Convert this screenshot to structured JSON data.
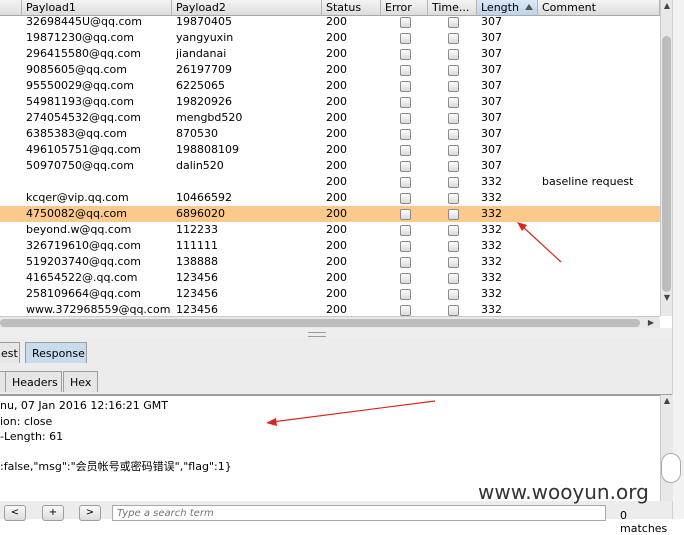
{
  "table": {
    "columns": [
      "Payload1",
      "Payload2",
      "Status",
      "Error",
      "Time...",
      "Length",
      "Comment"
    ],
    "rows": [
      {
        "p1": "32698445U@qq.com",
        "p2": "19870405",
        "status": "200",
        "length": "307",
        "comment": ""
      },
      {
        "p1": "19871230@qq.com",
        "p2": "yangyuxin",
        "status": "200",
        "length": "307",
        "comment": ""
      },
      {
        "p1": "296415580@qq.com",
        "p2": "jiandanai",
        "status": "200",
        "length": "307",
        "comment": ""
      },
      {
        "p1": "9085605@qq.com",
        "p2": "26197709",
        "status": "200",
        "length": "307",
        "comment": ""
      },
      {
        "p1": "95550029@qq.com",
        "p2": "6225065",
        "status": "200",
        "length": "307",
        "comment": ""
      },
      {
        "p1": "54981193@qq.com",
        "p2": "19820926",
        "status": "200",
        "length": "307",
        "comment": ""
      },
      {
        "p1": "274054532@qq.com",
        "p2": "mengbd520",
        "status": "200",
        "length": "307",
        "comment": ""
      },
      {
        "p1": "6385383@qq.com",
        "p2": "870530",
        "status": "200",
        "length": "307",
        "comment": ""
      },
      {
        "p1": "496105751@qq.com",
        "p2": "198808109",
        "status": "200",
        "length": "307",
        "comment": ""
      },
      {
        "p1": "50970750@qq.com",
        "p2": "dalin520",
        "status": "200",
        "length": "307",
        "comment": ""
      },
      {
        "p1": "",
        "p2": "",
        "status": "200",
        "length": "332",
        "comment": "baseline request"
      },
      {
        "p1": "kcqer@vip.qq.com",
        "p2": "10466592",
        "status": "200",
        "length": "332",
        "comment": ""
      },
      {
        "p1": "4750082@qq.com",
        "p2": "6896020",
        "status": "200",
        "length": "332",
        "comment": "",
        "selected": true
      },
      {
        "p1": "beyond.w@qq.com",
        "p2": "112233",
        "status": "200",
        "length": "332",
        "comment": ""
      },
      {
        "p1": "326719610@qq.com",
        "p2": "111111",
        "status": "200",
        "length": "332",
        "comment": ""
      },
      {
        "p1": "519203740@qq.com",
        "p2": "138888",
        "status": "200",
        "length": "332",
        "comment": ""
      },
      {
        "p1": "41654522@.qq.com",
        "p2": "123456",
        "status": "200",
        "length": "332",
        "comment": ""
      },
      {
        "p1": "258109664@qq.com",
        "p2": "123456",
        "status": "200",
        "length": "332",
        "comment": ""
      },
      {
        "p1": "www.372968559@qq.com",
        "p2": "123456",
        "status": "200",
        "length": "332",
        "comment": ""
      }
    ]
  },
  "tabs_top": [
    "est",
    "Response"
  ],
  "tabs_sub": [
    "Headers",
    "Hex"
  ],
  "response_lines": [
    "nu, 07 Jan 2016 12:16:21 GMT",
    "ion: close",
    "-Length: 61",
    "",
    ":false,\"msg\":\"会员帐号或密码错误\",\"flag\":1}"
  ],
  "search": {
    "prev_label": "<",
    "add_label": "+",
    "next_label": ">",
    "placeholder": "Type a search term",
    "matches": "0 matches"
  },
  "watermark": "www.wooyun.org",
  "colors": {
    "selected_row": "#fcc98c",
    "arrow": "#d8261e",
    "active_tab": "#c9dcee"
  }
}
